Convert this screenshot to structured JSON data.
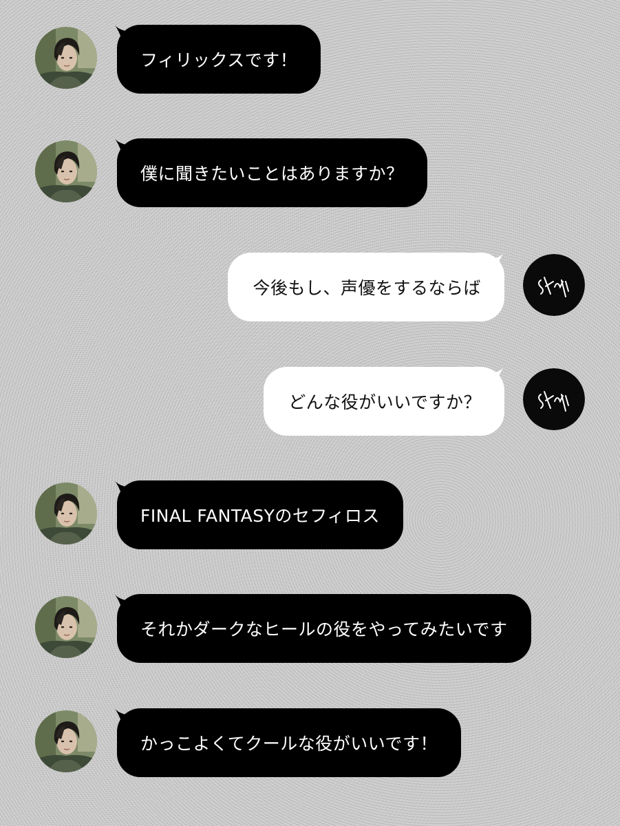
{
  "conversation": {
    "messages": [
      {
        "sender": "incoming",
        "text": "フィリックスです！"
      },
      {
        "sender": "incoming",
        "text": "僕に聞きたいことはありますか？"
      },
      {
        "sender": "outgoing",
        "text": "今後もし、声優をするならば"
      },
      {
        "sender": "outgoing",
        "text": "どんな役がいいですか？"
      },
      {
        "sender": "incoming",
        "text": "FINAL FANTASYのセフィロス"
      },
      {
        "sender": "incoming",
        "text": "それかダークなヒールの役をやってみたいです"
      },
      {
        "sender": "incoming",
        "text": "かっこよくてクールな役がいいです！"
      }
    ]
  },
  "avatars": {
    "incoming": {
      "icon": "person-photo-avatar"
    },
    "outgoing": {
      "icon": "signature-logo-avatar"
    }
  },
  "colors": {
    "background": "#c9c9c9",
    "incoming_bubble": "#000000",
    "incoming_text": "#ffffff",
    "outgoing_bubble": "#ffffff",
    "outgoing_text": "#111111"
  }
}
